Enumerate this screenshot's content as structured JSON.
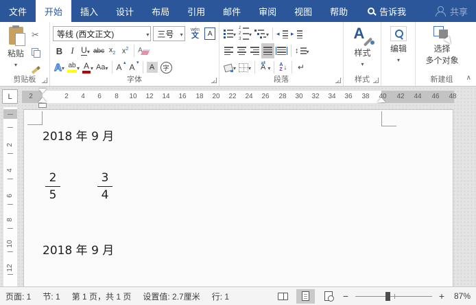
{
  "titlebar": {
    "tabs": [
      {
        "label": "文件",
        "active": false
      },
      {
        "label": "开始",
        "active": true
      },
      {
        "label": "插入",
        "active": false
      },
      {
        "label": "设计",
        "active": false
      },
      {
        "label": "布局",
        "active": false
      },
      {
        "label": "引用",
        "active": false
      },
      {
        "label": "邮件",
        "active": false
      },
      {
        "label": "审阅",
        "active": false
      },
      {
        "label": "视图",
        "active": false
      },
      {
        "label": "帮助",
        "active": false
      }
    ],
    "tell_me": "告诉我",
    "share": "共享"
  },
  "ribbon": {
    "clipboard": {
      "paste": "粘贴",
      "group": "剪贴板"
    },
    "font": {
      "name": "等线 (西文正文)",
      "size": "三号",
      "group": "字体",
      "bold": "B",
      "italic": "I",
      "underline": "U",
      "strikethrough": "abc",
      "sub_base": "x",
      "sub_mark": "2",
      "sup_base": "x",
      "sup_mark": "2",
      "effects": "A",
      "highlight": "ab",
      "font_color": "A",
      "change_case": "Aa",
      "grow": "A",
      "shrink": "A",
      "shading": "A",
      "enclose": "字",
      "phonetic_top": "wén",
      "phonetic_bottom": "文",
      "char_border": "A"
    },
    "paragraph": {
      "group": "段落",
      "sort_a": "A",
      "sort_z": "Z",
      "asian": "A"
    },
    "styles": {
      "label": "样式",
      "group": "样式",
      "glyph": "A"
    },
    "editing": {
      "label": "编辑"
    },
    "selection": {
      "line1": "选择",
      "line2": "多个对象",
      "group": "新建组"
    }
  },
  "ruler": {
    "tab_selector": "L",
    "left_margin_number": 2,
    "main_numbers": [
      2,
      4,
      6,
      8,
      10,
      12,
      14,
      16,
      18,
      20,
      22,
      24,
      26,
      28,
      30,
      32,
      34,
      36,
      38
    ],
    "right_numbers": [
      40,
      42,
      44,
      46,
      48
    ],
    "vertical_numbers": [
      2,
      4,
      6,
      8,
      10,
      12
    ]
  },
  "document": {
    "line1": "2018 年 9 月",
    "fractions": [
      {
        "numerator": "2",
        "denominator": "5"
      },
      {
        "numerator": "3",
        "denominator": "4"
      }
    ],
    "line2": "2018 年 9 月"
  },
  "statusbar": {
    "page": "页面: 1",
    "section": "节: 1",
    "page_count": "第 1 页，共 1 页",
    "setting": "设置值: 2.7厘米",
    "line": "行: 1",
    "zoom": "87%"
  },
  "colors": {
    "accent": "#2b579a",
    "highlight_yellow": "#ffff00",
    "font_color_red": "#c00000"
  }
}
